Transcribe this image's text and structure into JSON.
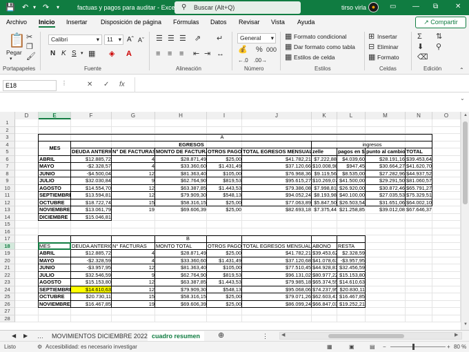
{
  "title": {
    "doc": "factuas y pagos para auditar  -  Excel",
    "search": "Buscar (Alt+Q)",
    "user": "tirso virla"
  },
  "menu": [
    "Archivo",
    "Inicio",
    "Insertar",
    "Disposición de página",
    "Fórmulas",
    "Datos",
    "Revisar",
    "Vista",
    "Ayuda"
  ],
  "share": "Compartir",
  "ribbon": {
    "paste": "Pegar",
    "font_name": "Calibri",
    "font_size": "11",
    "number_format": "General",
    "cond_format": "Formato condicional",
    "table_format": "Dar formato como tabla",
    "cell_styles": "Estilos de celda",
    "insert": "Insertar",
    "delete": "Eliminar",
    "format": "Formato",
    "groups": [
      "Portapapeles",
      "Fuente",
      "Alineación",
      "Número",
      "Estilos",
      "Celdas",
      "Edición"
    ]
  },
  "formula_bar": {
    "name_box": "E18",
    "content": ""
  },
  "columns": [
    "D",
    "E",
    "F",
    "G",
    "H",
    "I",
    "J",
    "K",
    "L",
    "M",
    "N",
    "O"
  ],
  "rows": [
    "1",
    "2",
    "3",
    "4",
    "5",
    "6",
    "7",
    "8",
    "9",
    "10",
    "11",
    "12",
    "13",
    "14",
    "15",
    "16",
    "17",
    "18",
    "19",
    "20",
    "21",
    "22",
    "23",
    "24",
    "25",
    "26",
    "27",
    "28"
  ],
  "tableA": {
    "label": "A",
    "mes": "MES",
    "egresos": "EGRESOS",
    "ingresos": "ingresos",
    "headers": [
      "DEUDA ANTERIOR",
      "N° DE FACTURAS",
      "MONTO DE FACTURAS",
      "OTROS PAGOS",
      "TOTAL EGRESOS MENSUALES",
      "zelle",
      "pagos en $",
      "punto al cambio",
      "TOTAL"
    ],
    "rows": [
      [
        "ABRIL",
        "$12.885,72",
        "4",
        "$28.871,49",
        "$25,00",
        "$41.782,21",
        "$7.222,88",
        "$4.039,60",
        "$28.191,16",
        "$39.453,64"
      ],
      [
        "MAYO",
        "-$2.328,57",
        "4",
        "$33.360,60",
        "$1.431,49",
        "$37.120,66",
        "$10.008,98",
        "$947,45",
        "$30.664,27",
        "$41.620,70"
      ],
      [
        "JUNIO",
        "-$4.500,04",
        "12",
        "$81.363,40",
        "$105,00",
        "$76.968,36",
        "$9.119,56",
        "$8.535,00",
        "$27.282,96",
        "$44.937,52"
      ],
      [
        "JULIO",
        "$32.030,84",
        "9",
        "$62.764,90",
        "$819,53",
        "$95.615,27",
        "$10.269,07",
        "$41.500,00",
        "$29.291,50",
        "$81.060,57"
      ],
      [
        "AGOSTO",
        "$14.554,70",
        "12",
        "$63.387,85",
        "$1.443,53",
        "$79.386,08",
        "$7.998,81",
        "$26.920,00",
        "$30.872,46",
        "$65.791,27"
      ],
      [
        "SEPTIEMBRE",
        "$13.594,81",
        "12",
        "$79.909,30",
        "$548,13",
        "$94.052,24",
        "$8.193,98",
        "$40.100,00",
        "$27.035,53",
        "$75.329,51"
      ],
      [
        "OCTUBRE",
        "$18.722,74",
        "15",
        "$58.316,15",
        "$25,00",
        "$77.063,89",
        "$5.847,50",
        "$26.503,54",
        "$31.651,06",
        "$64.002,10"
      ],
      [
        "NOVIEMBRE",
        "$13.061,79",
        "19",
        "$69.606,39",
        "$25,00",
        "$82.693,18",
        "$7.375,44",
        "$21.258,85",
        "$39.012,08",
        "$67.646,37"
      ],
      [
        "DICIEMBRE",
        "$15.046,81",
        "",
        "",
        "",
        "",
        "",
        "",
        "",
        ""
      ]
    ]
  },
  "tableB": {
    "label": "B",
    "headers": [
      "MES",
      "DEUDA ANTERIOR",
      "N° FACTURAS",
      "MONTO TOTAL",
      "OTROS PAGOS",
      "TOTAL EGRESOS MENSUALES",
      "ABONO",
      "RESTA"
    ],
    "rows": [
      [
        "ABRIL",
        "$12.885,72",
        "4",
        "$28.871,49",
        "$25,00",
        "$41.782,21",
        "$39.453,62",
        "$2.328,59"
      ],
      [
        "MAYO",
        "-$2.328,59",
        "4",
        "$33.360,60",
        "$1.431,49",
        "$37.120,68",
        "$41.078,63",
        "-$3.957,95"
      ],
      [
        "JUNIO",
        "-$3.957,95",
        "12",
        "$81.363,40",
        "$105,00",
        "$77.510,45",
        "$44.928,81",
        "$32.456,59"
      ],
      [
        "JULIO",
        "$32.546,59",
        "9",
        "$62.764,90",
        "$819,53",
        "$96.131,02",
        "$80.977,22",
        "$15.153,80"
      ],
      [
        "AGOSTO",
        "$15.153,80",
        "12",
        "$63.387,85",
        "$1.443,53",
        "$79.985,18",
        "$65.374,55",
        "$14.610,63"
      ],
      [
        "SEPTIEMBRE",
        "$14.610,63",
        "12",
        "$79.909,30",
        "$548,13",
        "$95.068,06",
        "$74.237,95",
        "$20.830,11"
      ],
      [
        "OCTUBRE",
        "$20.730,11",
        "15",
        "$58.316,15",
        "$25,00",
        "$79.071,26",
        "$62.603,41",
        "$16.467,85"
      ],
      [
        "NOVIEMBRE",
        "$16.467,85",
        "19",
        "$69.606,39",
        "$25,00",
        "$86.099,24",
        "$66.847,03",
        "$19.252,21"
      ]
    ]
  },
  "sheets": [
    "MOVIMIENTOS DICIEMBRE 2022",
    "cuadro resumen"
  ],
  "status": {
    "ready": "Listo",
    "accessibility": "Accesibilidad: es necesario investigar",
    "zoom": "80 %"
  },
  "colors": {
    "excel_green": "#107c41",
    "highlight_yellow": "#ffff00"
  }
}
